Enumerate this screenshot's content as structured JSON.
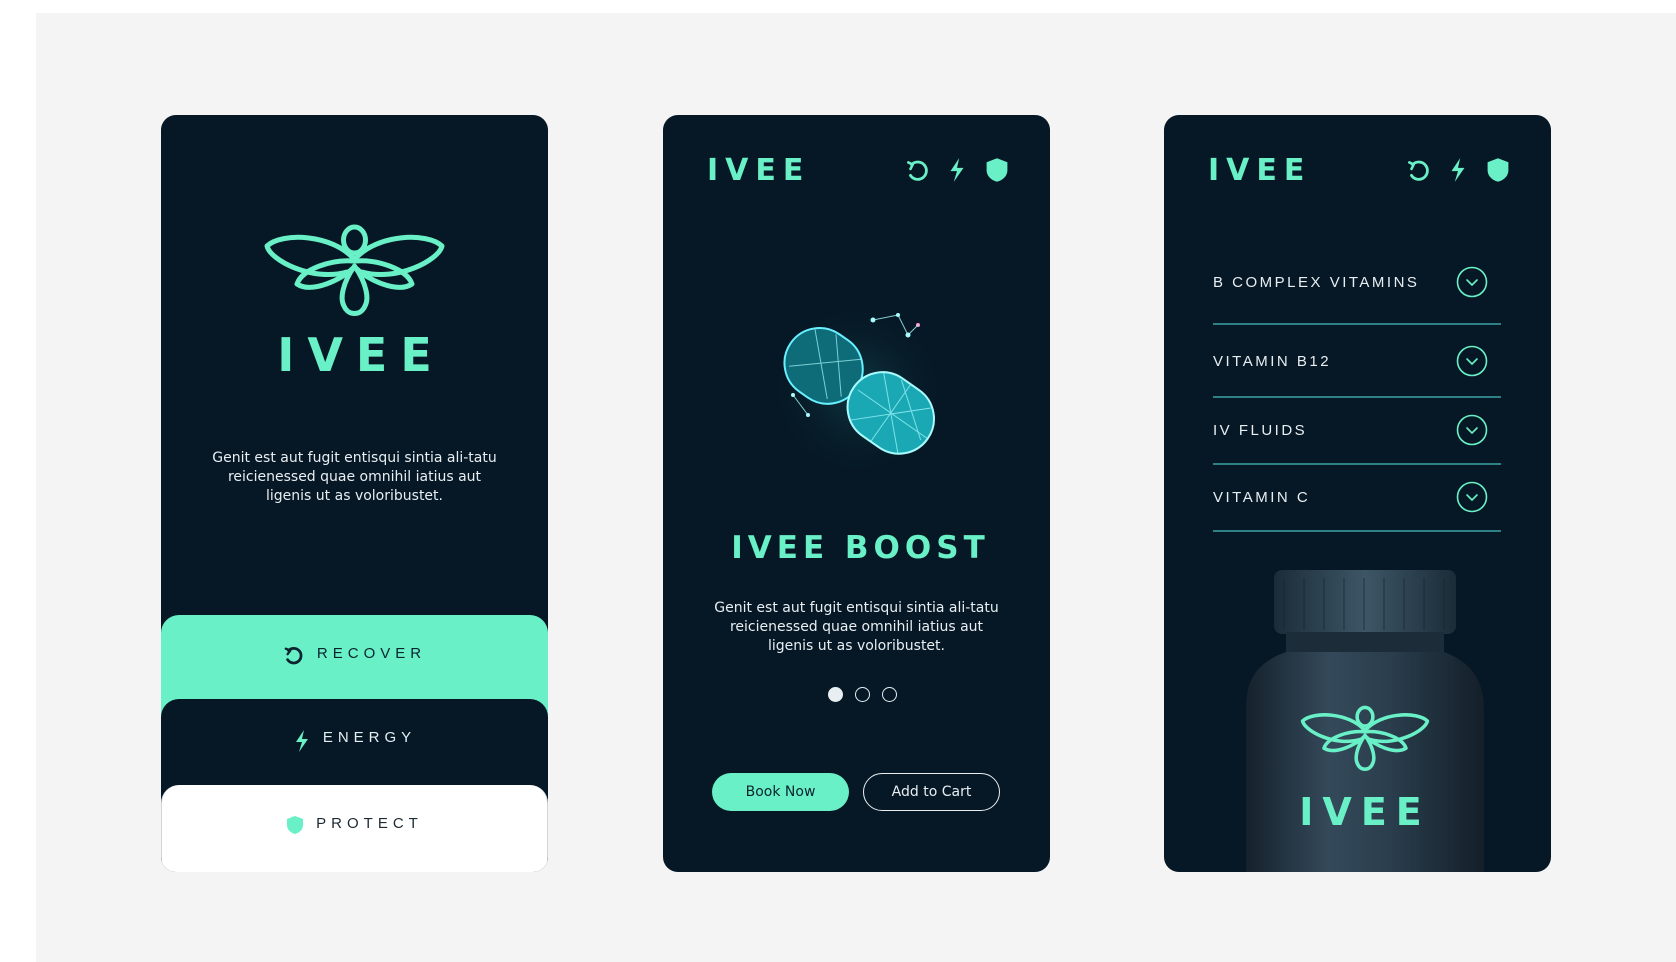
{
  "colors": {
    "mint": "#69f0c6",
    "navy": "#061825",
    "white": "#ffffff"
  },
  "screen1": {
    "logo_text": "IVEE",
    "intro": "Genit est aut fugit entisqui sintia ali-tatu reicienessed quae omnihil iatius aut ligenis ut as voloribustet.",
    "tabs": [
      {
        "label": "RECOVER",
        "icon": "recover-icon"
      },
      {
        "label": "ENERGY",
        "icon": "lightning-icon"
      },
      {
        "label": "PROTECT",
        "icon": "shield-icon"
      }
    ]
  },
  "screen2": {
    "brand": "IVEE",
    "product_title": "IVEE BOOST",
    "description": "Genit est aut fugit entisqui sintia ali-tatu reicienessed quae omnihil iatius aut ligenis ut as voloribustet.",
    "carousel": {
      "count": 3,
      "active": 1
    },
    "buttons": {
      "book": "Book Now",
      "cart": "Add to Cart"
    }
  },
  "screen3": {
    "brand": "IVEE",
    "accordion": [
      {
        "label": "B COMPLEX VITAMINS"
      },
      {
        "label": "VITAMIN B12"
      },
      {
        "label": "IV FLUIDS"
      },
      {
        "label": "VITAMIN C"
      }
    ],
    "bottle_label": "IVEE"
  }
}
